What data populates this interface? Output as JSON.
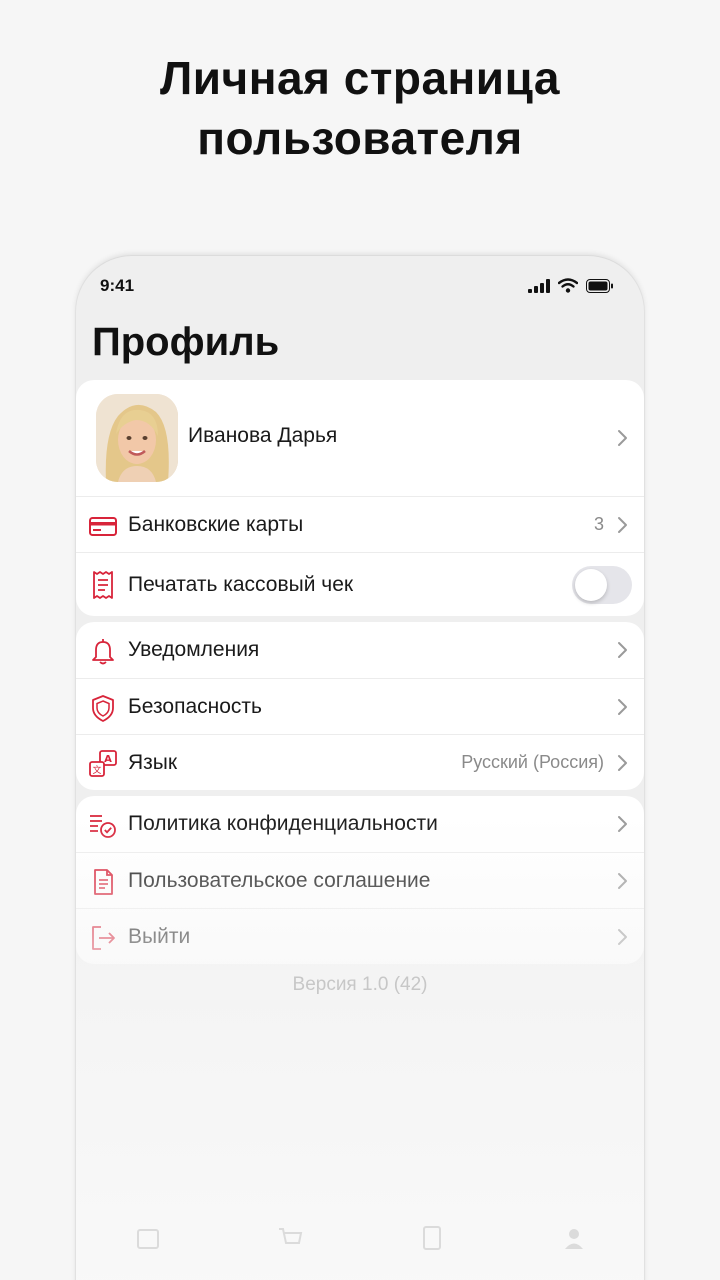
{
  "headline": {
    "line1": "Личная страница",
    "line2": "пользователя"
  },
  "status": {
    "time": "9:41"
  },
  "page_title": "Профиль",
  "profile": {
    "name": "Иванова Дарья"
  },
  "group1": {
    "bank_cards": {
      "label": "Банковские карты",
      "count": "3",
      "icon": "credit-card-icon"
    },
    "receipt": {
      "label": "Печатать кассовый чек",
      "icon": "receipt-icon",
      "toggle_on": false
    }
  },
  "group2": {
    "notifications": {
      "label": "Уведомления",
      "icon": "bell-icon"
    },
    "security": {
      "label": "Безопасность",
      "icon": "shield-icon"
    },
    "language": {
      "label": "Язык",
      "value": "Русский (Россия)",
      "icon": "translate-icon"
    }
  },
  "group3": {
    "privacy": {
      "label": "Политика конфиденциальности",
      "icon": "policy-icon"
    },
    "agreement": {
      "label": "Пользовательское соглашение",
      "icon": "document-icon"
    },
    "logout": {
      "label": "Выйти",
      "icon": "logout-icon"
    }
  },
  "version": "Версия 1.0 (42)",
  "colors": {
    "accent": "#d8243a",
    "background": "#f6f6f6",
    "card": "#ffffff",
    "secondary_text": "#8a8a8a"
  }
}
